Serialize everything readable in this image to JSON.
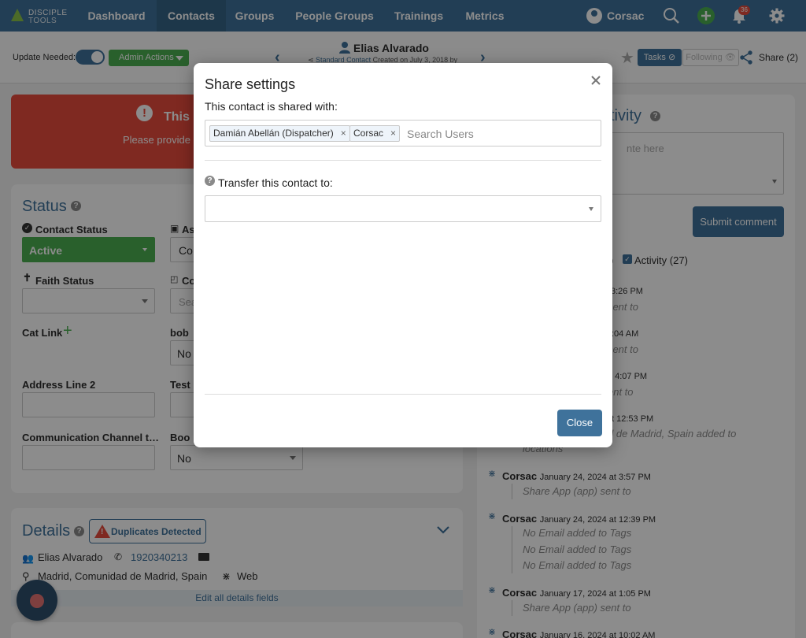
{
  "nav": {
    "logo_line1": "DISCIPLE",
    "logo_line2": "TOOLS",
    "links": [
      "Dashboard",
      "Contacts",
      "Groups",
      "People Groups",
      "Trainings",
      "Metrics"
    ],
    "active": "Contacts",
    "user_name": "Corsac",
    "notification_count": "36",
    "accent_color": "#3f729b"
  },
  "subheader": {
    "update_needed_label": "Update Needed:",
    "admin_actions_label": "Admin Actions",
    "contact_name": "Elias Alvarado",
    "contact_type": "Standard Contact",
    "created_text": "Created on July 3, 2018 by",
    "tasks_label": "Tasks",
    "following_label": "Following",
    "share_label": "Share (2)"
  },
  "alert": {
    "title": "This",
    "message": "Please provide"
  },
  "status": {
    "title": "Status",
    "contact_status_label": "Contact Status",
    "contact_status_value": "Active",
    "assigned_label": "As",
    "assigned_value": "Co",
    "faith_status_label": "Faith Status",
    "coaching_label": "Co",
    "coaching_placeholder": "Sea",
    "cat_link_label": "Cat Link",
    "bob_label": "bob",
    "bob_value": "No",
    "address_line2_label": "Address Line 2",
    "test_label": "Test",
    "comm_channel_label": "Communication Channel t…",
    "boo_label": "Boo",
    "boo_value": "No"
  },
  "details": {
    "title": "Details",
    "duplicates_label": "Duplicates Detected",
    "name": "Elias Alvarado",
    "phone": "1920340213",
    "location": "Madrid, Comunidad de Madrid, Spain",
    "source": "Web",
    "edit_link": "Edit all details fields"
  },
  "activity": {
    "title": "ctivity",
    "comment_placeholder": "nte here",
    "submit_label": "Submit comment",
    "filter_fragment": ")",
    "filter_label": "Activity (27)",
    "entries": [
      {
        "time": "3:26 PM",
        "lines": [
          ") sent to"
        ]
      },
      {
        "time": ":04 AM",
        "lines": [
          ") sent to"
        ]
      },
      {
        "time": "t 4:07 PM",
        "lines": [
          "ent to"
        ]
      },
      {
        "time": "t 12:53 PM",
        "lines": [
          "d de Madrid, Spain added to",
          "locations"
        ]
      },
      {
        "user": "Corsac",
        "time": "January 24, 2024 at 3:57 PM",
        "lines": [
          "Share App (app) sent to"
        ]
      },
      {
        "user": "Corsac",
        "time": "January 24, 2024 at 12:39 PM",
        "lines": [
          "No Email added to Tags",
          "No Email added to Tags",
          "No Email added to Tags"
        ]
      },
      {
        "user": "Corsac",
        "time": "January 17, 2024 at 1:05 PM",
        "lines": [
          "Share App (app) sent to"
        ]
      },
      {
        "user": "Corsac",
        "time": "January 16, 2024 at 10:02 AM",
        "lines": []
      }
    ]
  },
  "modal": {
    "title": "Share settings",
    "shared_with_label": "This contact is shared with:",
    "shared_users": [
      "Damián Abellán (Dispatcher)",
      "Corsac"
    ],
    "search_placeholder": "Search Users",
    "transfer_label": "Transfer this contact to:",
    "close_label": "Close"
  }
}
